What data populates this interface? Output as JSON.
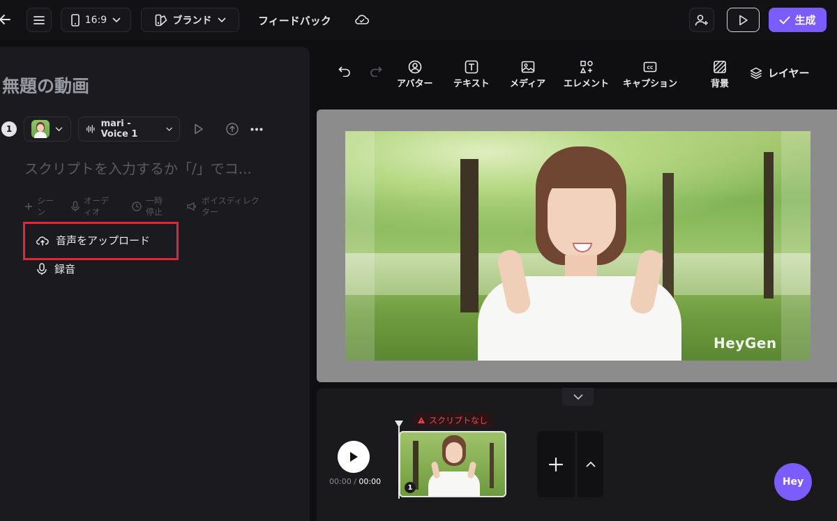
{
  "topbar": {
    "aspect_ratio": "16:9",
    "brand_label": "ブランド",
    "feedback_label": "フィードバック",
    "generate_label": "生成"
  },
  "editor": {
    "title": "無題の動画",
    "scene_number": "1",
    "voice_label": "mari - Voice 1",
    "script_placeholder": "スクリプトを入力するか「/」でコ...",
    "small_tools": [
      {
        "label": "シー\nン"
      },
      {
        "label": "オーデ\nィオ"
      },
      {
        "label": "一時\n停止"
      },
      {
        "label": "ボイスディレク\nター"
      }
    ],
    "audio_menu": {
      "upload_label": "音声をアップロード",
      "record_label": "録音"
    }
  },
  "toolbar": {
    "avatar": "アバター",
    "text": "テキスト",
    "media": "メディア",
    "element": "エレメント",
    "caption": "キャプション",
    "background": "背景",
    "layers": "レイヤー"
  },
  "canvas": {
    "watermark": "HeyGen"
  },
  "timeline": {
    "current_time": "00:00",
    "separator": " / ",
    "total_time": "00:00",
    "warning": "スクリプトなし",
    "clip_number": "1"
  },
  "assistant": {
    "label": "Hey"
  },
  "colors": {
    "accent": "#7b5cff",
    "highlight": "#e1263a",
    "warning": "#e84a55"
  }
}
